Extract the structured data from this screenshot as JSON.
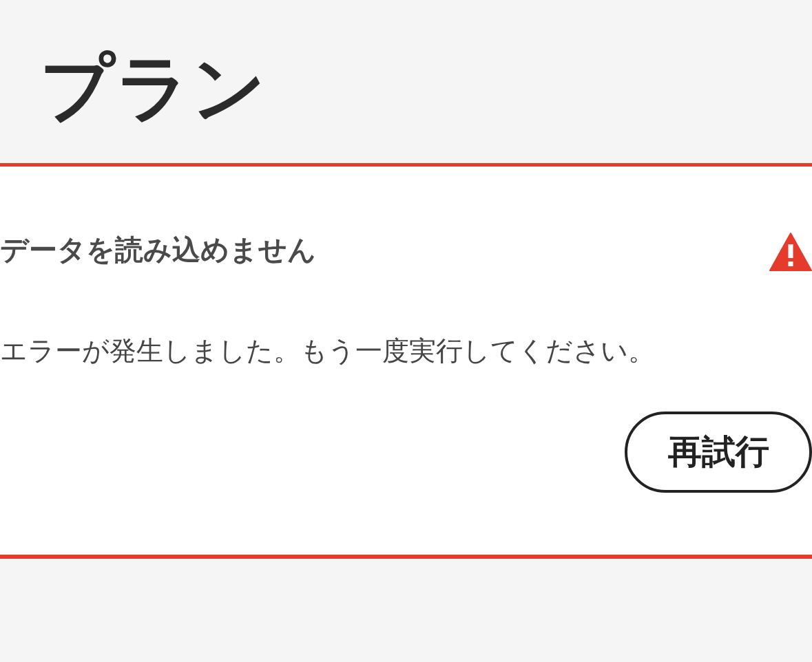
{
  "page": {
    "title": "プラン"
  },
  "error_card": {
    "heading": "データを読み込めません",
    "message": "エラーが発生しました。もう一度実行してください。",
    "retry_button": "再試行"
  }
}
